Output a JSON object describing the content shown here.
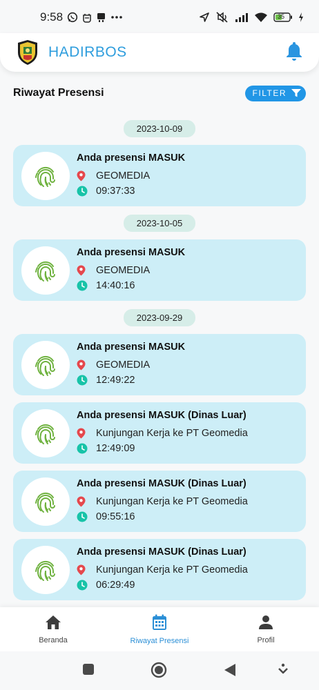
{
  "status_bar": {
    "time": "9:58",
    "battery": "35",
    "left_icons": [
      "whatsapp-icon",
      "app-icon",
      "robot-icon",
      "more-dots-icon"
    ],
    "right_icons": [
      "location-arrow-icon",
      "mute-icon",
      "signal-icon",
      "wifi-icon",
      "battery-icon",
      "charging-icon"
    ]
  },
  "app_bar": {
    "title": "HADIRBOS",
    "logo": "crest-logo",
    "notification_icon": "bell-icon"
  },
  "page": {
    "title": "Riwayat Presensi",
    "filter_label": "FILTER"
  },
  "groups": [
    {
      "date": "2023-10-09",
      "entries": [
        {
          "title": "Anda presensi MASUK",
          "location": "GEOMEDIA",
          "time": "09:37:33"
        }
      ]
    },
    {
      "date": "2023-10-05",
      "entries": [
        {
          "title": "Anda presensi MASUK",
          "location": "GEOMEDIA",
          "time": "14:40:16"
        }
      ]
    },
    {
      "date": "2023-09-29",
      "entries": [
        {
          "title": "Anda presensi MASUK",
          "location": "GEOMEDIA",
          "time": "12:49:22"
        },
        {
          "title": "Anda presensi MASUK (Dinas Luar)",
          "location": "Kunjungan Kerja ke PT Geomedia",
          "time": "12:49:09"
        },
        {
          "title": "Anda presensi MASUK (Dinas Luar)",
          "location": "Kunjungan Kerja ke PT Geomedia",
          "time": "09:55:16"
        },
        {
          "title": "Anda presensi MASUK (Dinas Luar)",
          "location": "Kunjungan Kerja ke PT Geomedia",
          "time": "06:29:49"
        }
      ]
    }
  ],
  "bottom_nav": {
    "items": [
      {
        "label": "Beranda",
        "icon": "home-icon",
        "active": false
      },
      {
        "label": "Riwayat Presensi",
        "icon": "calendar-icon",
        "active": true
      },
      {
        "label": "Profil",
        "icon": "person-icon",
        "active": false
      }
    ]
  },
  "colors": {
    "brand": "#2e9ddd",
    "card_bg": "#cdeef7",
    "date_chip_bg": "#d6ede8",
    "filter_bg": "#2196e6",
    "fingerprint": "#6fb23f",
    "location_pin": "#e5484d",
    "clock": "#17c3a8"
  }
}
